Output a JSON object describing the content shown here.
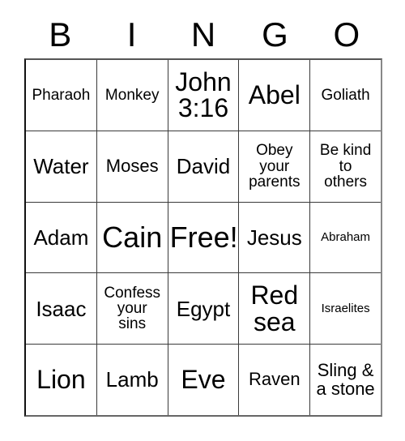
{
  "header": {
    "letters": [
      "B",
      "I",
      "N",
      "G",
      "O"
    ]
  },
  "grid": {
    "rows": [
      [
        {
          "text": "Pharaoh",
          "size": "s-sm"
        },
        {
          "text": "Monkey",
          "size": "s-sm"
        },
        {
          "text": "John\n3:16",
          "size": "s-xl"
        },
        {
          "text": "Abel",
          "size": "s-xl"
        },
        {
          "text": "Goliath",
          "size": "s-sm"
        }
      ],
      [
        {
          "text": "Water",
          "size": "s-lg"
        },
        {
          "text": "Moses",
          "size": "s-md"
        },
        {
          "text": "David",
          "size": "s-lg"
        },
        {
          "text": "Obey\nyour\nparents",
          "size": "s-sm"
        },
        {
          "text": "Be kind\nto\nothers",
          "size": "s-sm"
        }
      ],
      [
        {
          "text": "Adam",
          "size": "s-lg"
        },
        {
          "text": "Cain",
          "size": "s-xxl"
        },
        {
          "text": "Free!",
          "size": "s-xxl"
        },
        {
          "text": "Jesus",
          "size": "s-lg"
        },
        {
          "text": "Abraham",
          "size": "s-xs"
        }
      ],
      [
        {
          "text": "Isaac",
          "size": "s-lg"
        },
        {
          "text": "Confess\nyour\nsins",
          "size": "s-sm"
        },
        {
          "text": "Egypt",
          "size": "s-lg"
        },
        {
          "text": "Red\nsea",
          "size": "s-xl"
        },
        {
          "text": "Israelites",
          "size": "s-xs"
        }
      ],
      [
        {
          "text": "Lion",
          "size": "s-xl"
        },
        {
          "text": "Lamb",
          "size": "s-lg"
        },
        {
          "text": "Eve",
          "size": "s-xl"
        },
        {
          "text": "Raven",
          "size": "s-md"
        },
        {
          "text": "Sling &\na stone",
          "size": "s-md"
        }
      ]
    ]
  }
}
